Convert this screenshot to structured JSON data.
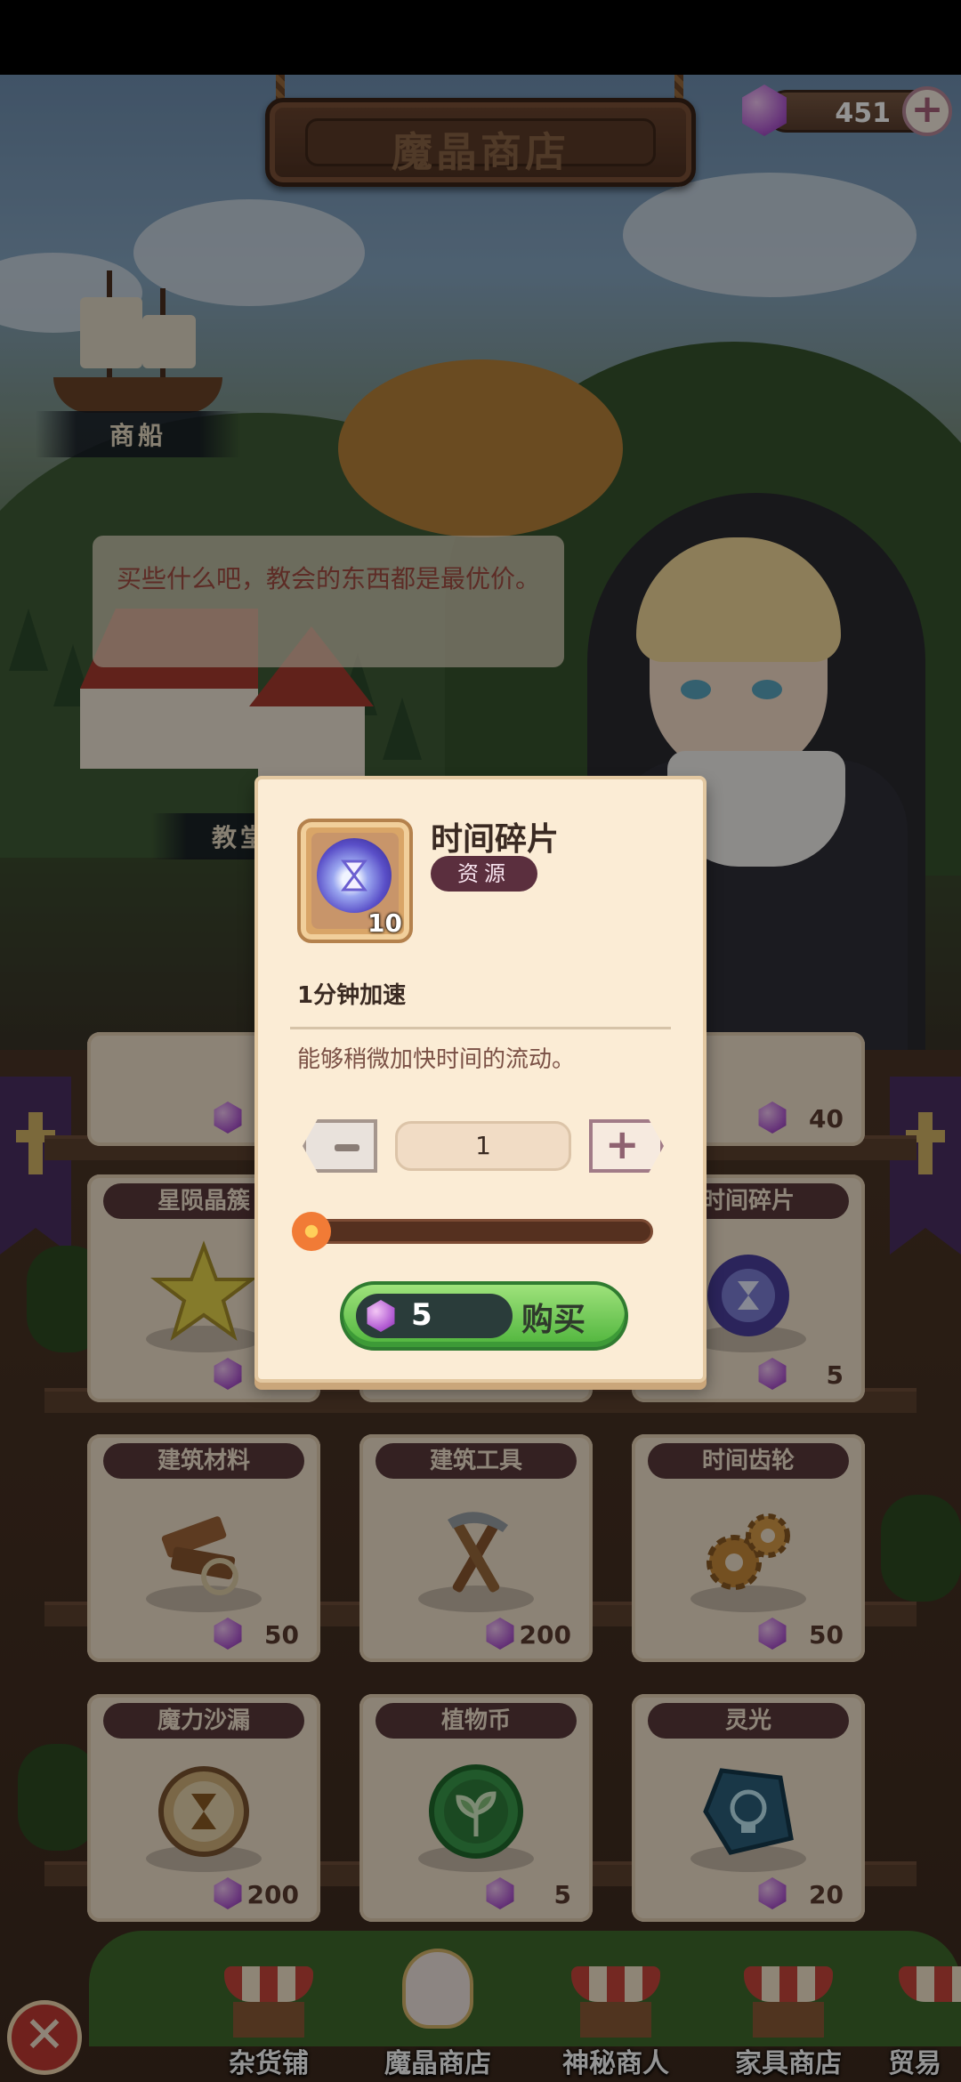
{
  "header": {
    "title": "魔晶商店",
    "currency_amount": "451",
    "currency_icon": "magic-crystal-icon",
    "add_icon": "plus-icon"
  },
  "scene": {
    "ship_label": "商船",
    "church_label": "教堂",
    "speech": "买些什么吧，教会的东西都是最优价。"
  },
  "shop": {
    "cards_row0": [
      {
        "name": "",
        "price": ""
      },
      {
        "name": "",
        "price": ""
      },
      {
        "name": "",
        "price": "40"
      }
    ],
    "cards_row1": [
      {
        "name": "星陨晶簇",
        "price": ""
      },
      {
        "name": "",
        "price": ""
      },
      {
        "name": "时间碎片",
        "price": "5"
      }
    ],
    "cards_row2": [
      {
        "name": "建筑材料",
        "price": "50"
      },
      {
        "name": "建筑工具",
        "price": "200"
      },
      {
        "name": "时间齿轮",
        "price": "50"
      }
    ],
    "cards_row3": [
      {
        "name": "魔力沙漏",
        "price": "200"
      },
      {
        "name": "植物币",
        "price": "5"
      },
      {
        "name": "灵光",
        "price": "20"
      }
    ]
  },
  "dialog": {
    "item_name": "时间碎片",
    "item_tag": "资源",
    "item_quantity": "10",
    "item_icon": "hourglass-orb-icon",
    "effect": "1分钟加速",
    "description": "能够稍微加快时间的流动。",
    "quantity_value": "1",
    "slider_level": 0.0,
    "buy_price": "5",
    "buy_label": "购买",
    "accent_color": "#4fb43c"
  },
  "bottom_nav": {
    "items": [
      {
        "label": "杂货铺"
      },
      {
        "label": "魔晶商店"
      },
      {
        "label": "神秘商人"
      },
      {
        "label": "家具商店"
      },
      {
        "label": "贸易"
      }
    ],
    "close_icon": "close-x-icon"
  }
}
